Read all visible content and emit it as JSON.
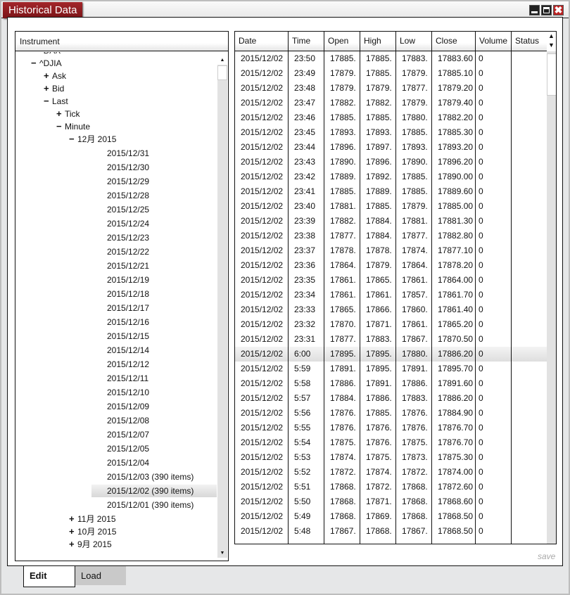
{
  "window": {
    "title": "Historical Data",
    "close_glyph": "✖"
  },
  "tree": {
    "header": "Instrument",
    "nodes": [
      {
        "label": "^DAX",
        "level": 0,
        "icon": "·"
      },
      {
        "label": "^DJIA",
        "level": 0,
        "icon": "−"
      },
      {
        "label": "Ask",
        "level": 1,
        "icon": "+"
      },
      {
        "label": "Bid",
        "level": 1,
        "icon": "+"
      },
      {
        "label": "Last",
        "level": 1,
        "icon": "−"
      },
      {
        "label": "Tick",
        "level": 2,
        "icon": "+"
      },
      {
        "label": "Minute",
        "level": 2,
        "icon": "−"
      },
      {
        "label": "12月 2015",
        "level": 3,
        "icon": "−"
      },
      {
        "label": "2015/12/31",
        "level": 4
      },
      {
        "label": "2015/12/30",
        "level": 4
      },
      {
        "label": "2015/12/29",
        "level": 4
      },
      {
        "label": "2015/12/28",
        "level": 4
      },
      {
        "label": "2015/12/25",
        "level": 4
      },
      {
        "label": "2015/12/24",
        "level": 4
      },
      {
        "label": "2015/12/23",
        "level": 4
      },
      {
        "label": "2015/12/22",
        "level": 4
      },
      {
        "label": "2015/12/21",
        "level": 4
      },
      {
        "label": "2015/12/19",
        "level": 4
      },
      {
        "label": "2015/12/18",
        "level": 4
      },
      {
        "label": "2015/12/17",
        "level": 4
      },
      {
        "label": "2015/12/16",
        "level": 4
      },
      {
        "label": "2015/12/15",
        "level": 4
      },
      {
        "label": "2015/12/14",
        "level": 4
      },
      {
        "label": "2015/12/12",
        "level": 4
      },
      {
        "label": "2015/12/11",
        "level": 4
      },
      {
        "label": "2015/12/10",
        "level": 4
      },
      {
        "label": "2015/12/09",
        "level": 4
      },
      {
        "label": "2015/12/08",
        "level": 4
      },
      {
        "label": "2015/12/07",
        "level": 4
      },
      {
        "label": "2015/12/05",
        "level": 4
      },
      {
        "label": "2015/12/04",
        "level": 4
      },
      {
        "label": "2015/12/03 (390 items)",
        "level": 4
      },
      {
        "label": "2015/12/02 (390 items)",
        "level": 4,
        "selected": true
      },
      {
        "label": "2015/12/01 (390 items)",
        "level": 4
      },
      {
        "label": "11月 2015",
        "level": 3,
        "icon": "+"
      },
      {
        "label": "10月 2015",
        "level": 3,
        "icon": "+"
      },
      {
        "label": "9月 2015",
        "level": 3,
        "icon": "+"
      }
    ]
  },
  "table": {
    "columns": [
      "Date",
      "Time",
      "Open",
      "High",
      "Low",
      "Close",
      "Volume",
      "Status"
    ],
    "selected_row": 20,
    "rows": [
      [
        "2015/12/02",
        "23:50",
        "17885.",
        "17885.",
        "17883.",
        "17883.60",
        "0",
        ""
      ],
      [
        "2015/12/02",
        "23:49",
        "17879.",
        "17885.",
        "17879.",
        "17885.10",
        "0",
        ""
      ],
      [
        "2015/12/02",
        "23:48",
        "17879.",
        "17879.",
        "17877.",
        "17879.20",
        "0",
        ""
      ],
      [
        "2015/12/02",
        "23:47",
        "17882.",
        "17882.",
        "17879.",
        "17879.40",
        "0",
        ""
      ],
      [
        "2015/12/02",
        "23:46",
        "17885.",
        "17885.",
        "17880.",
        "17882.20",
        "0",
        ""
      ],
      [
        "2015/12/02",
        "23:45",
        "17893.",
        "17893.",
        "17885.",
        "17885.30",
        "0",
        ""
      ],
      [
        "2015/12/02",
        "23:44",
        "17896.",
        "17897.",
        "17893.",
        "17893.20",
        "0",
        ""
      ],
      [
        "2015/12/02",
        "23:43",
        "17890.",
        "17896.",
        "17890.",
        "17896.20",
        "0",
        ""
      ],
      [
        "2015/12/02",
        "23:42",
        "17889.",
        "17892.",
        "17885.",
        "17890.00",
        "0",
        ""
      ],
      [
        "2015/12/02",
        "23:41",
        "17885.",
        "17889.",
        "17885.",
        "17889.60",
        "0",
        ""
      ],
      [
        "2015/12/02",
        "23:40",
        "17881.",
        "17885.",
        "17879.",
        "17885.00",
        "0",
        ""
      ],
      [
        "2015/12/02",
        "23:39",
        "17882.",
        "17884.",
        "17881.",
        "17881.30",
        "0",
        ""
      ],
      [
        "2015/12/02",
        "23:38",
        "17877.",
        "17884.",
        "17877.",
        "17882.80",
        "0",
        ""
      ],
      [
        "2015/12/02",
        "23:37",
        "17878.",
        "17878.",
        "17874.",
        "17877.10",
        "0",
        ""
      ],
      [
        "2015/12/02",
        "23:36",
        "17864.",
        "17879.",
        "17864.",
        "17878.20",
        "0",
        ""
      ],
      [
        "2015/12/02",
        "23:35",
        "17861.",
        "17865.",
        "17861.",
        "17864.00",
        "0",
        ""
      ],
      [
        "2015/12/02",
        "23:34",
        "17861.",
        "17861.",
        "17857.",
        "17861.70",
        "0",
        ""
      ],
      [
        "2015/12/02",
        "23:33",
        "17865.",
        "17866.",
        "17860.",
        "17861.40",
        "0",
        ""
      ],
      [
        "2015/12/02",
        "23:32",
        "17870.",
        "17871.",
        "17861.",
        "17865.20",
        "0",
        ""
      ],
      [
        "2015/12/02",
        "23:31",
        "17877.",
        "17883.",
        "17867.",
        "17870.50",
        "0",
        ""
      ],
      [
        "2015/12/02",
        "6:00",
        "17895.",
        "17895.",
        "17880.",
        "17886.20",
        "0",
        ""
      ],
      [
        "2015/12/02",
        "5:59",
        "17891.",
        "17895.",
        "17891.",
        "17895.70",
        "0",
        ""
      ],
      [
        "2015/12/02",
        "5:58",
        "17886.",
        "17891.",
        "17886.",
        "17891.60",
        "0",
        ""
      ],
      [
        "2015/12/02",
        "5:57",
        "17884.",
        "17886.",
        "17883.",
        "17886.20",
        "0",
        ""
      ],
      [
        "2015/12/02",
        "5:56",
        "17876.",
        "17885.",
        "17876.",
        "17884.90",
        "0",
        ""
      ],
      [
        "2015/12/02",
        "5:55",
        "17876.",
        "17876.",
        "17876.",
        "17876.70",
        "0",
        ""
      ],
      [
        "2015/12/02",
        "5:54",
        "17875.",
        "17876.",
        "17875.",
        "17876.70",
        "0",
        ""
      ],
      [
        "2015/12/02",
        "5:53",
        "17874.",
        "17875.",
        "17873.",
        "17875.30",
        "0",
        ""
      ],
      [
        "2015/12/02",
        "5:52",
        "17872.",
        "17874.",
        "17872.",
        "17874.00",
        "0",
        ""
      ],
      [
        "2015/12/02",
        "5:51",
        "17868.",
        "17872.",
        "17868.",
        "17872.60",
        "0",
        ""
      ],
      [
        "2015/12/02",
        "5:50",
        "17868.",
        "17871.",
        "17868.",
        "17868.60",
        "0",
        ""
      ],
      [
        "2015/12/02",
        "5:49",
        "17868.",
        "17869.",
        "17868.",
        "17868.50",
        "0",
        ""
      ],
      [
        "2015/12/02",
        "5:48",
        "17867.",
        "17868.",
        "17867.",
        "17868.50",
        "0",
        ""
      ]
    ]
  },
  "footer": {
    "save_label": "save"
  },
  "tabs": {
    "edit": "Edit",
    "load": "Load"
  }
}
